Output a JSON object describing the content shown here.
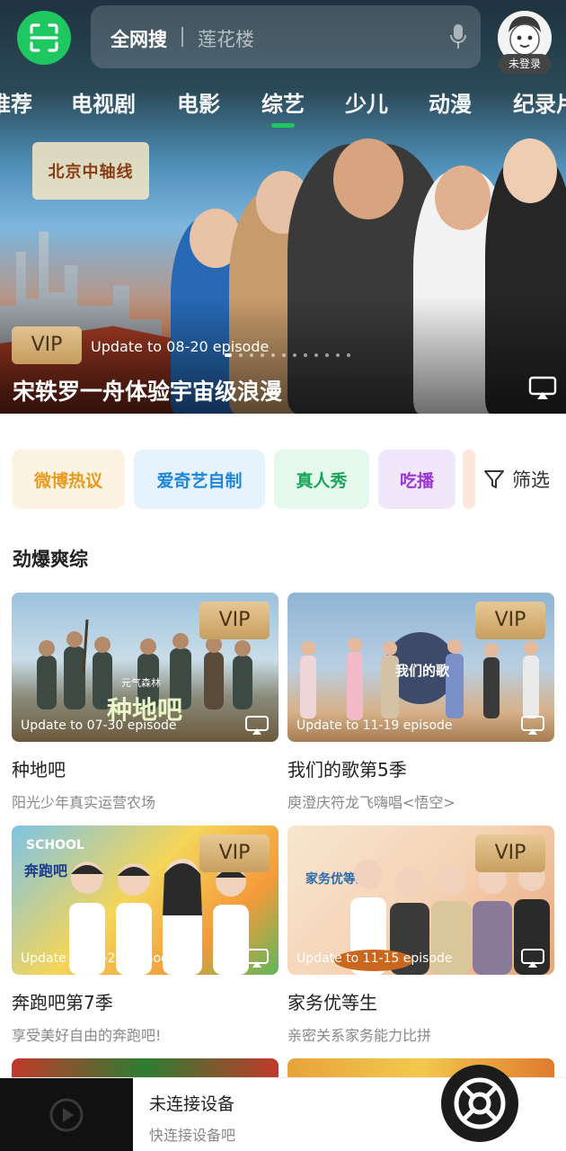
{
  "header": {
    "search_scope": "全网搜",
    "search_hint": "莲花楼",
    "login_badge": "未登录"
  },
  "tabs": [
    {
      "label": "推荐"
    },
    {
      "label": "电视剧"
    },
    {
      "label": "电影"
    },
    {
      "label": "综艺",
      "active": true
    },
    {
      "label": "少儿"
    },
    {
      "label": "动漫"
    },
    {
      "label": "纪录片"
    }
  ],
  "banner": {
    "vip": "VIP",
    "update": "Update to 08-20 episode",
    "title": "宋轶罗一舟体验宇宙级浪漫",
    "logo_text": "北京中轴线"
  },
  "chips": [
    {
      "label": "微博热议",
      "color": "#e79a1e",
      "bg": "#fdf3e2"
    },
    {
      "label": "爱奇艺自制",
      "color": "#1f86d9",
      "bg": "#e6f3fd"
    },
    {
      "label": "真人秀",
      "color": "#1aa65a",
      "bg": "#e5f8ec"
    },
    {
      "label": "吃播",
      "color": "#9b35d6",
      "bg": "#f1e7fb"
    }
  ],
  "filter": {
    "label": "筛选"
  },
  "section": {
    "title": "劲爆爽综"
  },
  "cards": [
    {
      "vip": "VIP",
      "update": "Update to 07-30 episode",
      "title": "种地吧",
      "subtitle": "阳光少年真实运营农场",
      "overlay": "种地吧",
      "tag": "元气森林"
    },
    {
      "vip": "VIP",
      "update": "Update to 11-19 episode",
      "title": "我们的歌第5季",
      "subtitle": "庾澄庆符龙飞嗨唱<悟空>",
      "overlay": "我们的歌",
      "tag": ""
    },
    {
      "vip": "VIP",
      "update": "Update to 07-24 episode",
      "title": "奔跑吧第7季",
      "subtitle": "享受美好自由的奔跑吧!",
      "overlay": "奔跑吧",
      "tag": "SCHOOL"
    },
    {
      "vip": "VIP",
      "update": "Update to 11-15 episode",
      "title": "家务优等生",
      "subtitle": "亲密关系家务能力比拼",
      "overlay": "家务优等生",
      "tag": ""
    }
  ],
  "cast_bar": {
    "title": "未连接设备",
    "subtitle": "快连接设备吧"
  },
  "colors": {
    "accent": "#1ec75f",
    "vip_gold": "#c59c5e"
  }
}
